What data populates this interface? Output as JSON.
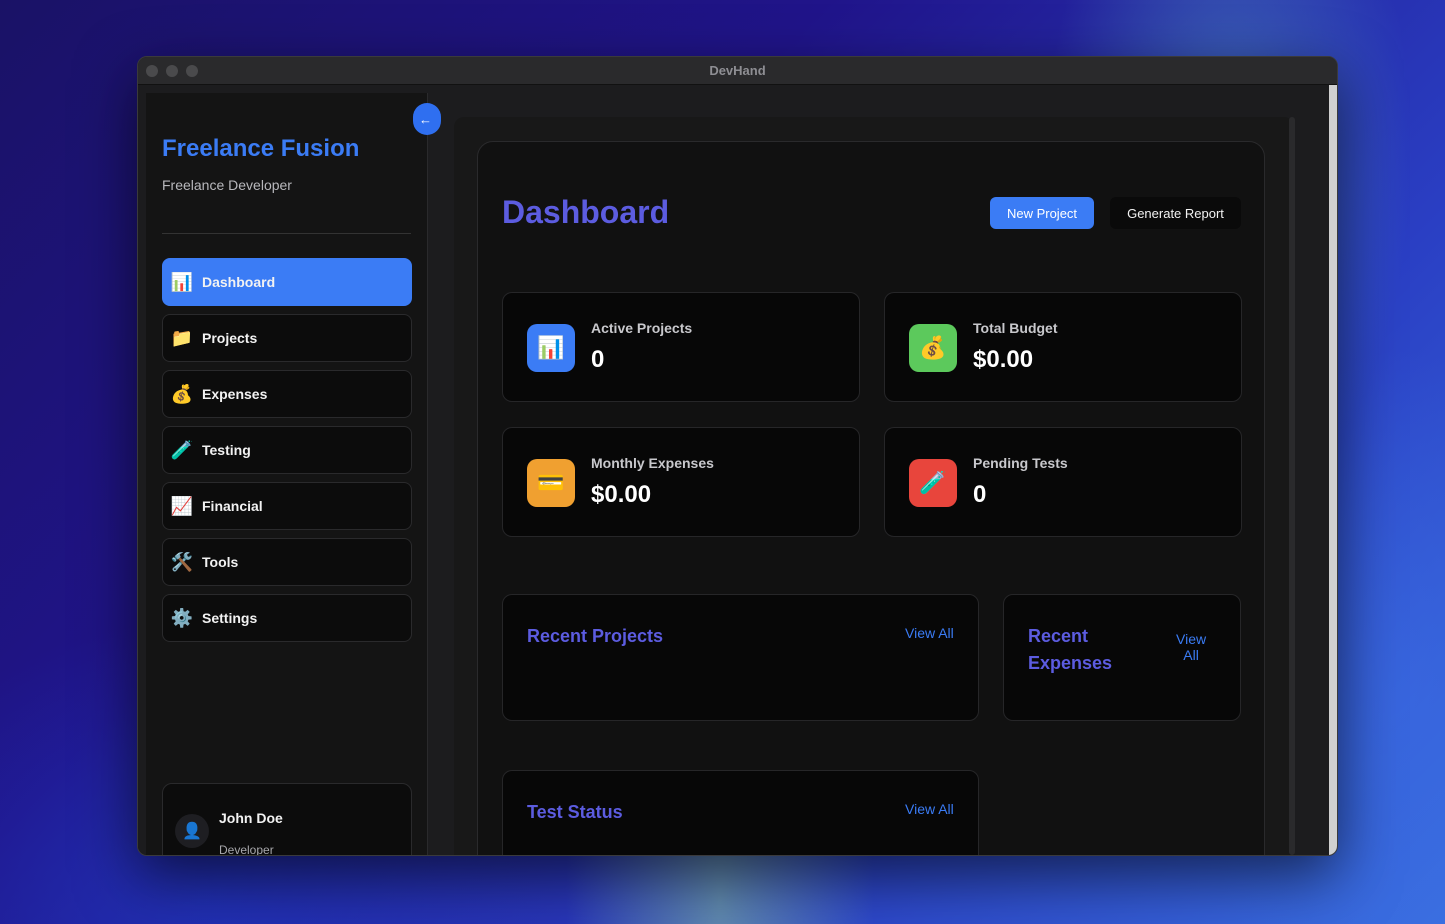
{
  "window": {
    "title": "DevHand"
  },
  "sidebar": {
    "collapse_icon": "arrow-left-icon",
    "collapse_glyph": "←",
    "brand": "Freelance Fusion",
    "role": "Freelance Developer",
    "items": [
      {
        "label": "Dashboard",
        "icon": "bar-chart-icon",
        "glyph": "📊",
        "active": true
      },
      {
        "label": "Projects",
        "icon": "folder-icon",
        "glyph": "📁",
        "active": false
      },
      {
        "label": "Expenses",
        "icon": "money-bag-icon",
        "glyph": "💰",
        "active": false
      },
      {
        "label": "Testing",
        "icon": "test-tube-icon",
        "glyph": "🧪",
        "active": false
      },
      {
        "label": "Financial",
        "icon": "chart-increasing-icon",
        "glyph": "📈",
        "active": false
      },
      {
        "label": "Tools",
        "icon": "hammer-wrench-icon",
        "glyph": "🛠️",
        "active": false
      },
      {
        "label": "Settings",
        "icon": "gear-icon",
        "glyph": "⚙️",
        "active": false
      }
    ],
    "user": {
      "name": "John Doe",
      "role": "Developer",
      "avatar_icon": "user-silhouette-icon",
      "avatar_glyph": "👤"
    }
  },
  "main": {
    "title": "Dashboard",
    "new_project_label": "New Project",
    "generate_report_label": "Generate Report",
    "stats": [
      {
        "label": "Active Projects",
        "value": "0",
        "icon": "bar-chart-icon",
        "glyph": "📊",
        "color": "#3b7cf5"
      },
      {
        "label": "Total Budget",
        "value": "$0.00",
        "icon": "money-bag-icon",
        "glyph": "💰",
        "color": "#5cc95c"
      },
      {
        "label": "Monthly Expenses",
        "value": "$0.00",
        "icon": "credit-card-icon",
        "glyph": "💳",
        "color": "#f0a030"
      },
      {
        "label": "Pending Tests",
        "value": "0",
        "icon": "test-tube-icon",
        "glyph": "🧪",
        "color": "#e8453c"
      }
    ],
    "recent_projects": {
      "title": "Recent Projects",
      "view_all": "View All"
    },
    "recent_expenses": {
      "title_line1": "Recent",
      "title_line2": "Expenses",
      "view_all_line1": "View",
      "view_all_line2": "All"
    },
    "test_status": {
      "title": "Test Status",
      "view_all": "View All"
    }
  },
  "colors": {
    "accent": "#3b7cf5",
    "heading": "#5c5ce0"
  }
}
